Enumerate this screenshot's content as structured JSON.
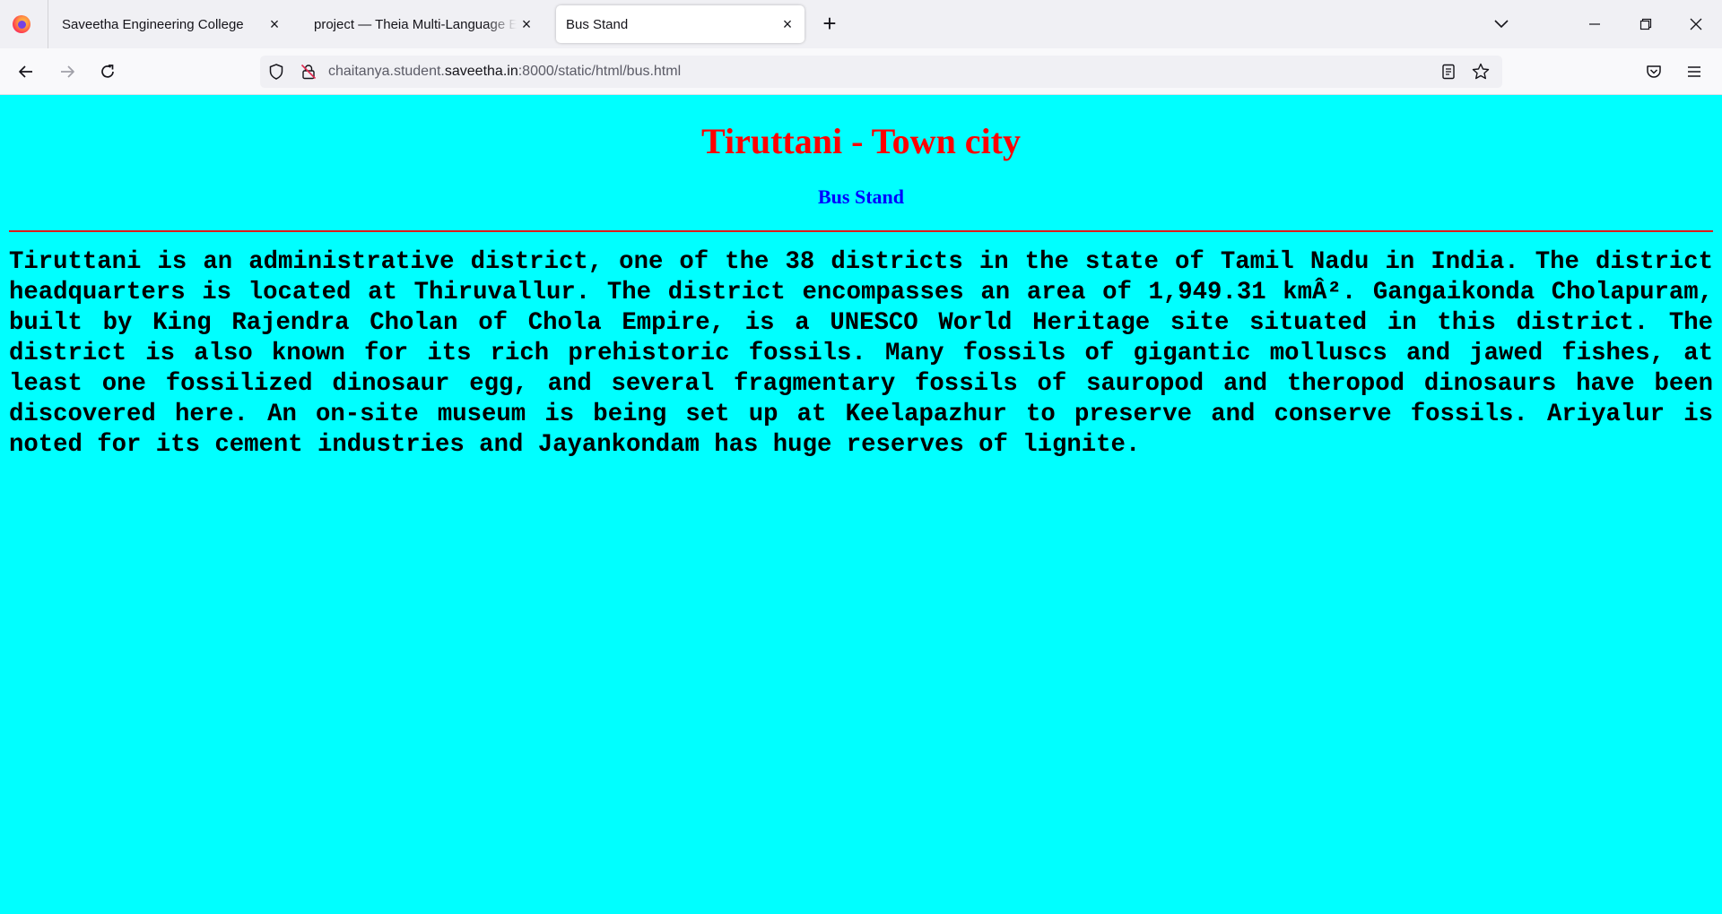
{
  "browser": {
    "tabs": [
      {
        "title": "Saveetha Engineering College",
        "active": false
      },
      {
        "title": "project — Theia Multi-Language Explorer",
        "active": false
      },
      {
        "title": "Bus Stand",
        "active": true
      }
    ],
    "url": {
      "prefix": "chaitanya.student.",
      "domain": "saveetha.in",
      "suffix": ":8000/static/html/bus.html"
    },
    "icons": {
      "close": "×",
      "new_tab": "+"
    }
  },
  "page": {
    "background_color": "#00ffff",
    "heading": "Tiruttani - Town city",
    "heading_color": "#ff0000",
    "subheading": "Bus Stand",
    "subheading_color": "#0000ff",
    "paragraph": "Tiruttani is an administrative district, one of the 38 districts in the state of Tamil Nadu in India. The district headquarters is located at Thiruvallur. The district encompasses an area of 1,949.31 kmÂ². Gangaikonda Cholapuram, built by King Rajendra Cholan of Chola Empire, is a UNESCO World Heritage site situated in this district. The district is also known for its rich prehistoric fossils. Many fossils of gigantic molluscs and jawed fishes, at least one fossilized dinosaur egg, and several fragmentary fossils of sauropod and theropod dinosaurs have been discovered here. An on-site museum is being set up at Keelapazhur to preserve and conserve fossils. Ariyalur is noted for its cement industries and Jayankondam has huge reserves of lignite."
  }
}
